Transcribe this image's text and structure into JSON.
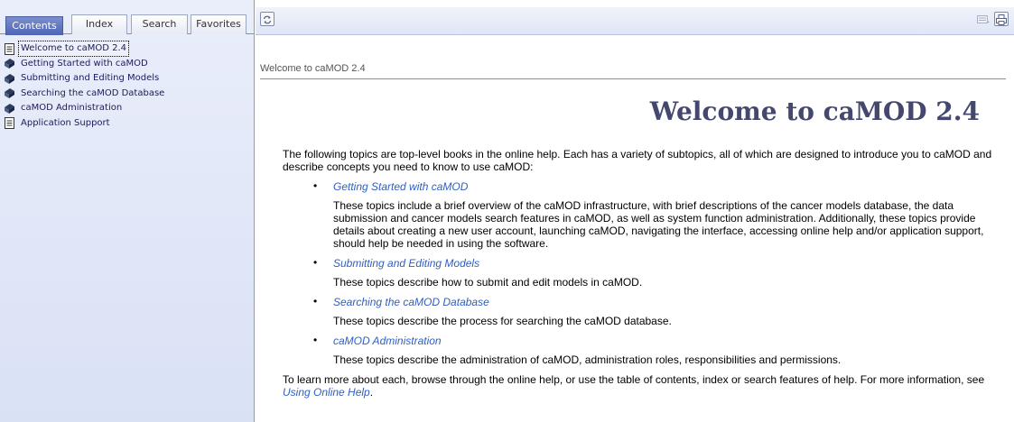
{
  "nav": {
    "tabs": [
      "Contents",
      "Index",
      "Search",
      "Favorites"
    ],
    "active_tab": "Contents",
    "toc": [
      {
        "label": "Welcome to caMOD 2.4",
        "icon": "page-icon",
        "selected": true
      },
      {
        "label": "Getting Started with caMOD",
        "icon": "book-icon"
      },
      {
        "label": "Submitting and Editing Models",
        "icon": "book-icon"
      },
      {
        "label": "Searching the caMOD Database",
        "icon": "book-icon"
      },
      {
        "label": "caMOD Administration",
        "icon": "book-icon"
      },
      {
        "label": "Application Support",
        "icon": "page-icon"
      }
    ]
  },
  "toolbar": {
    "sync_icon": "sync-toc-icon",
    "email_icon": "email-icon",
    "print_icon": "print-icon"
  },
  "content": {
    "breadcrumb": "Welcome to caMOD 2.4",
    "title": "Welcome to caMOD 2.4",
    "intro": "The following topics are top-level books in the online help. Each has a variety of subtopics, all of which are designed to introduce you to caMOD and describe concepts you need to know to use caMOD:",
    "topics": [
      {
        "link": "Getting Started with caMOD",
        "description": "These topics include a brief overview of the caMOD infrastructure, with brief descriptions of the cancer models database, the data submission and cancer models search features in caMOD, as well as system function administration. Additionally, these topics provide details about creating a new user account, launching caMOD, navigating the interface, accessing online help and/or application support, should help be needed in using the software."
      },
      {
        "link": "Submitting and Editing Models",
        "description": "These topics describe how to submit and edit models in caMOD."
      },
      {
        "link": "Searching the caMOD Database",
        "description": "These topics describe the process for searching the caMOD database."
      },
      {
        "link": "caMOD Administration",
        "description": "These topics describe the administration of caMOD, administration roles, responsibilities and permissions."
      }
    ],
    "footer_prefix": "To learn more about each, browse through the online help, or use the table of contents, index or search features of help. For more information, see ",
    "footer_link": "Using Online Help",
    "footer_suffix": "."
  },
  "colors": {
    "link": "#2e5fc4",
    "title": "#44486e",
    "active_tab": "#5a6fbe",
    "nav_background": "#dfe5f7"
  }
}
